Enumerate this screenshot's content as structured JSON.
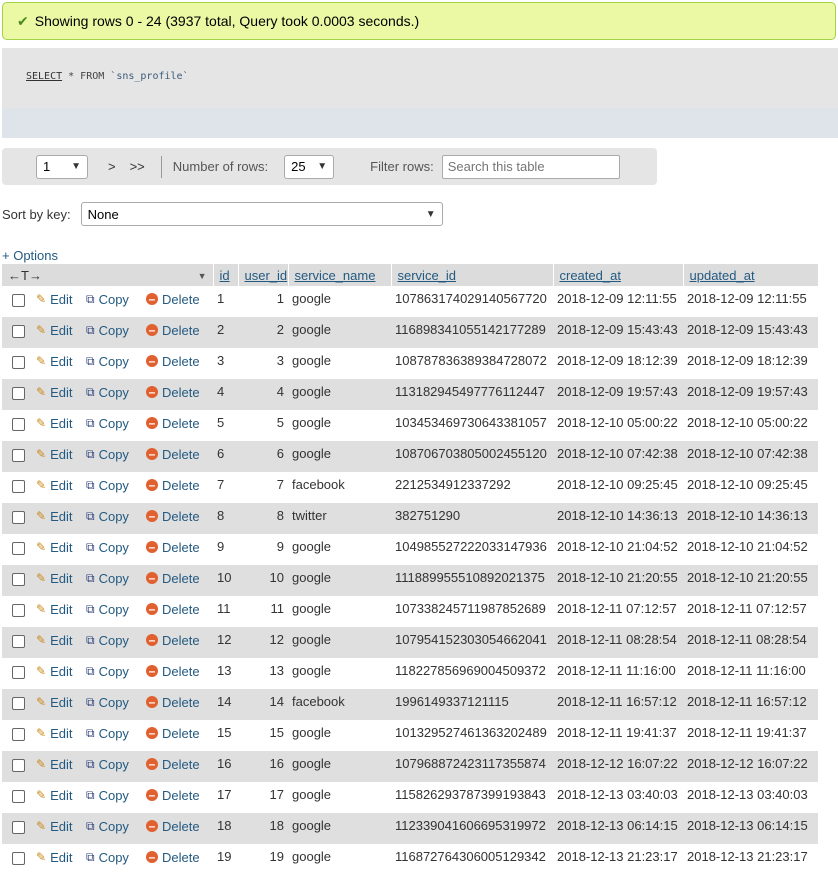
{
  "success_message": "Showing rows 0 - 24 (3937 total, Query took 0.0003 seconds.)",
  "query": {
    "keyword": "SELECT",
    "rest": " * FROM ",
    "table": "`sns_profile`"
  },
  "navigation": {
    "page_value": "1",
    "next_label": ">",
    "last_label": ">>",
    "rows_label": "Number of rows:",
    "rows_value": "25",
    "filter_label": "Filter rows:",
    "filter_placeholder": "Search this table"
  },
  "sort": {
    "label": "Sort by key:",
    "value": "None"
  },
  "options_label": "+ Options",
  "columns": [
    "id",
    "user_id",
    "service_name",
    "service_id",
    "created_at",
    "updated_at"
  ],
  "actions": {
    "edit": "Edit",
    "copy": "Copy",
    "delete": "Delete"
  },
  "rows": [
    [
      "1",
      "1",
      "google",
      "107863174029140567720",
      "2018-12-09 12:11:55",
      "2018-12-09 12:11:55"
    ],
    [
      "2",
      "2",
      "google",
      "116898341055142177289",
      "2018-12-09 15:43:43",
      "2018-12-09 15:43:43"
    ],
    [
      "3",
      "3",
      "google",
      "108787836389384728072",
      "2018-12-09 18:12:39",
      "2018-12-09 18:12:39"
    ],
    [
      "4",
      "4",
      "google",
      "113182945497776112447",
      "2018-12-09 19:57:43",
      "2018-12-09 19:57:43"
    ],
    [
      "5",
      "5",
      "google",
      "103453469730643381057",
      "2018-12-10 05:00:22",
      "2018-12-10 05:00:22"
    ],
    [
      "6",
      "6",
      "google",
      "108706703805002455120",
      "2018-12-10 07:42:38",
      "2018-12-10 07:42:38"
    ],
    [
      "7",
      "7",
      "facebook",
      "2212534912337292",
      "2018-12-10 09:25:45",
      "2018-12-10 09:25:45"
    ],
    [
      "8",
      "8",
      "twitter",
      "382751290",
      "2018-12-10 14:36:13",
      "2018-12-10 14:36:13"
    ],
    [
      "9",
      "9",
      "google",
      "104985527222033147936",
      "2018-12-10 21:04:52",
      "2018-12-10 21:04:52"
    ],
    [
      "10",
      "10",
      "google",
      "111889955510892021375",
      "2018-12-10 21:20:55",
      "2018-12-10 21:20:55"
    ],
    [
      "11",
      "11",
      "google",
      "107338245711987852689",
      "2018-12-11 07:12:57",
      "2018-12-11 07:12:57"
    ],
    [
      "12",
      "12",
      "google",
      "107954152303054662041",
      "2018-12-11 08:28:54",
      "2018-12-11 08:28:54"
    ],
    [
      "13",
      "13",
      "google",
      "118227856969004509372",
      "2018-12-11 11:16:00",
      "2018-12-11 11:16:00"
    ],
    [
      "14",
      "14",
      "facebook",
      "1996149337121115",
      "2018-12-11 16:57:12",
      "2018-12-11 16:57:12"
    ],
    [
      "15",
      "15",
      "google",
      "101329527461363202489",
      "2018-12-11 19:41:37",
      "2018-12-11 19:41:37"
    ],
    [
      "16",
      "16",
      "google",
      "107968872423117355874",
      "2018-12-12 16:07:22",
      "2018-12-12 16:07:22"
    ],
    [
      "17",
      "17",
      "google",
      "115826293787399193843",
      "2018-12-13 03:40:03",
      "2018-12-13 03:40:03"
    ],
    [
      "18",
      "18",
      "google",
      "112339041606695319972",
      "2018-12-13 06:14:15",
      "2018-12-13 06:14:15"
    ],
    [
      "19",
      "19",
      "google",
      "116872764306005129342",
      "2018-12-13 21:23:17",
      "2018-12-13 21:23:17"
    ]
  ]
}
